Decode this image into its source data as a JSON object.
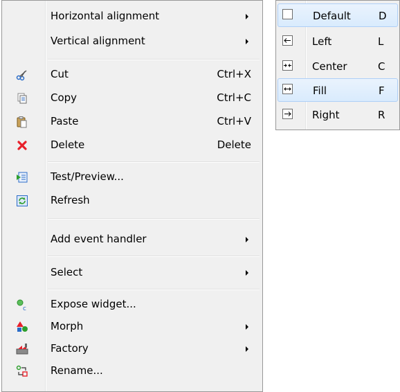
{
  "context_menu": {
    "items": [
      {
        "label": "Horizontal alignment",
        "shortcut": "",
        "submenu": true,
        "icon": ""
      },
      {
        "label": "Vertical alignment",
        "shortcut": "",
        "submenu": true,
        "icon": ""
      },
      {
        "label": "Cut",
        "shortcut": "Ctrl+X",
        "submenu": false,
        "icon": "scissors-icon"
      },
      {
        "label": "Copy",
        "shortcut": "Ctrl+C",
        "submenu": false,
        "icon": "copy-icon"
      },
      {
        "label": "Paste",
        "shortcut": "Ctrl+V",
        "submenu": false,
        "icon": "paste-icon"
      },
      {
        "label": "Delete",
        "shortcut": "Delete",
        "submenu": false,
        "icon": "delete-icon"
      },
      {
        "label": "Test/Preview...",
        "shortcut": "",
        "submenu": false,
        "icon": "preview-icon"
      },
      {
        "label": "Refresh",
        "shortcut": "",
        "submenu": false,
        "icon": "refresh-icon"
      },
      {
        "label": "Add event handler",
        "shortcut": "",
        "submenu": true,
        "icon": ""
      },
      {
        "label": "Select",
        "shortcut": "",
        "submenu": true,
        "icon": ""
      },
      {
        "label": "Expose widget...",
        "shortcut": "",
        "submenu": false,
        "icon": "expose-icon"
      },
      {
        "label": "Morph",
        "shortcut": "",
        "submenu": true,
        "icon": "morph-icon"
      },
      {
        "label": "Factory",
        "shortcut": "",
        "submenu": true,
        "icon": "factory-icon"
      },
      {
        "label": "Rename...",
        "shortcut": "",
        "submenu": false,
        "icon": "rename-icon"
      }
    ]
  },
  "alignment_submenu": {
    "items": [
      {
        "label": "Default",
        "key": "D",
        "icon": "align-default-icon",
        "glyph": ""
      },
      {
        "label": "Left",
        "key": "L",
        "icon": "align-left-icon",
        "glyph": "←"
      },
      {
        "label": "Center",
        "key": "C",
        "icon": "align-center-icon",
        "glyph": "→←"
      },
      {
        "label": "Fill",
        "key": "F",
        "icon": "align-fill-icon",
        "glyph": "↔"
      },
      {
        "label": "Right",
        "key": "R",
        "icon": "align-right-icon",
        "glyph": "→"
      }
    ],
    "highlighted": [
      "Default",
      "Fill"
    ]
  },
  "colors": {
    "menu_bg": "#f0f0f0",
    "border": "#979797",
    "highlight_border": "#aecff7",
    "delete_red": "#e8202a",
    "green": "#2d9f2d",
    "blue": "#2a6cc8"
  }
}
